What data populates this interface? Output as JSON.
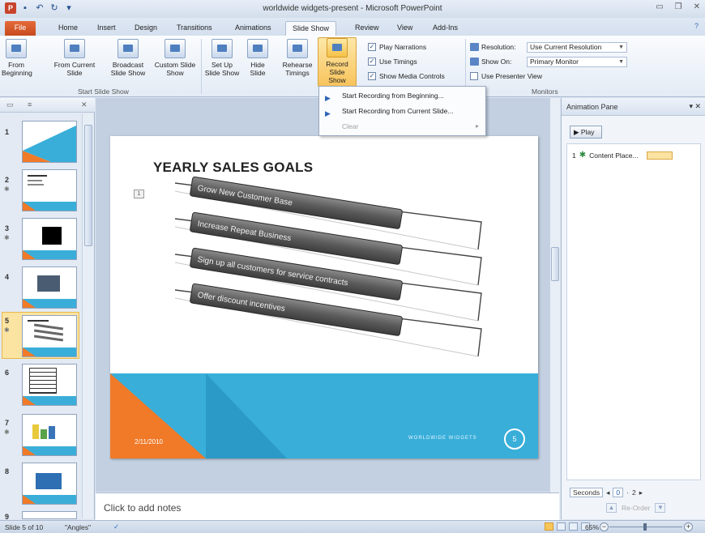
{
  "window": {
    "title": "worldwide widgets-present - Microsoft PowerPoint"
  },
  "tabs": [
    "File",
    "Home",
    "Insert",
    "Design",
    "Transitions",
    "Animations",
    "Slide Show",
    "Review",
    "View",
    "Add-Ins"
  ],
  "ribbon": {
    "start_group": {
      "label": "Start Slide Show",
      "from_beginning": "From Beginning",
      "from_current": "From Current Slide",
      "broadcast": "Broadcast Slide Show",
      "custom": "Custom Slide Show"
    },
    "setup_group": {
      "setup": "Set Up Slide Show",
      "hide": "Hide Slide",
      "rehearse": "Rehearse Timings",
      "record": "Record Slide Show"
    },
    "checks": {
      "play_narrations": "Play Narrations",
      "use_timings": "Use Timings",
      "show_media_controls": "Show Media Controls"
    },
    "monitors_group": {
      "label": "Monitors",
      "resolution_label": "Resolution:",
      "resolution_value": "Use Current Resolution",
      "show_on_label": "Show On:",
      "show_on_value": "Primary Monitor",
      "presenter_view": "Use Presenter View"
    }
  },
  "record_menu": {
    "items": [
      "Start Recording from Beginning...",
      "Start Recording from Current Slide...",
      "Clear"
    ]
  },
  "slide": {
    "title": "YEARLY SALES GOALS",
    "anim_tag": "1",
    "goals": [
      "Grow New Customer Base",
      "Increase Repeat Business",
      "Sign up all customers for service contracts",
      "Offer discount incentives"
    ],
    "date": "2/11/2010",
    "footer": "WORLDWIDE WIDGETS",
    "number": "5"
  },
  "thumbnails": {
    "numbers": [
      "1",
      "2",
      "3",
      "4",
      "5",
      "6",
      "7",
      "8",
      "9"
    ],
    "selected": 5
  },
  "notes": {
    "placeholder": "Click to add notes"
  },
  "animation_pane": {
    "title": "Animation Pane",
    "play": "Play",
    "item_number": "1",
    "item_label": "Content Place...",
    "seconds": "Seconds",
    "timeline_start": "0",
    "timeline_next": "2",
    "reorder": "Re-Order"
  },
  "status": {
    "slide_info": "Slide 5 of 10",
    "theme": "\"Angles\"",
    "zoom": "65%"
  },
  "colors": {
    "accent_orange": "#f07a28",
    "accent_blue": "#38aed9",
    "record_highlight": "#f8c35c"
  }
}
